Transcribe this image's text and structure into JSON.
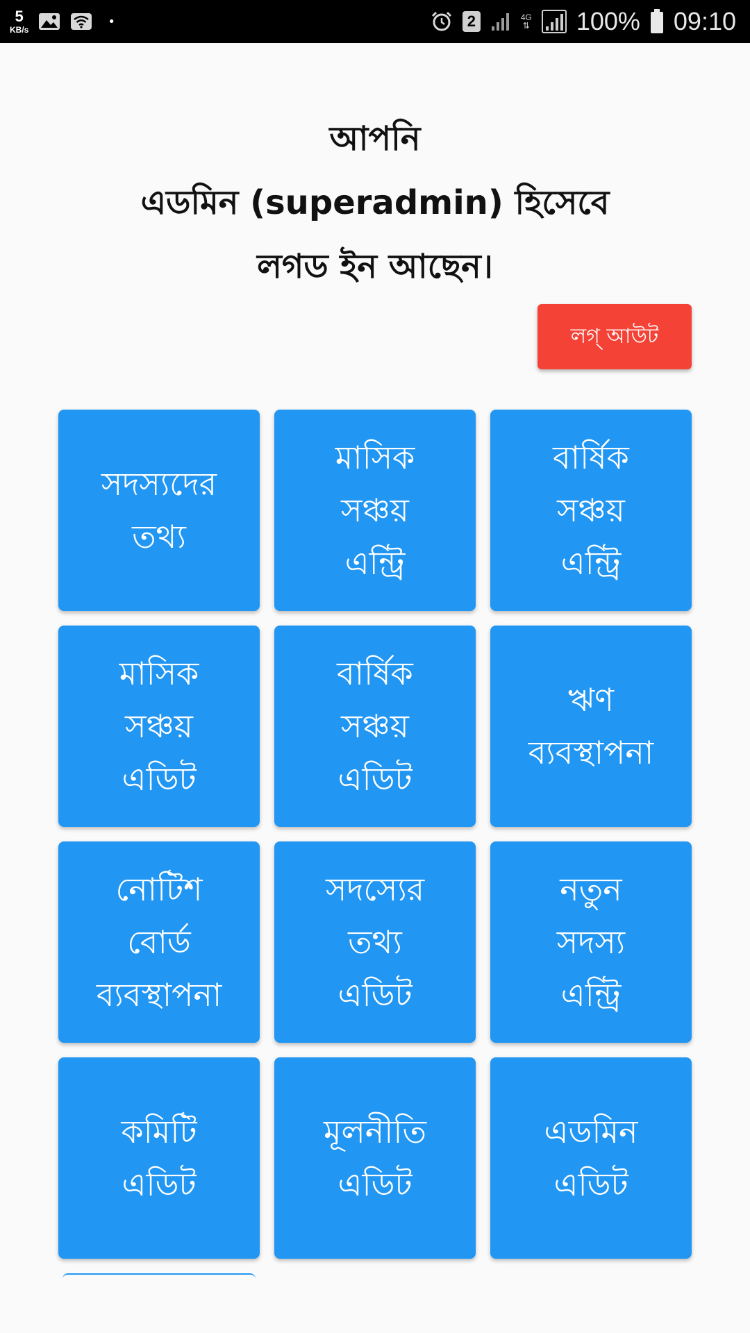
{
  "status_bar": {
    "speed_value": "5",
    "speed_unit": "KB/s",
    "dot": "•",
    "sim_badge": "2",
    "network_type": "4G",
    "battery_percent": "100%",
    "time": "09:10"
  },
  "header": {
    "line1": "আপনি",
    "line2": "এডমিন (superadmin) হিসেবে",
    "line3": "লগড ইন আছেন।"
  },
  "logout_label": "লগ্ আউট",
  "colors": {
    "tile_blue": "#2196f3",
    "logout_red": "#f44336"
  },
  "tiles": [
    "সদস্যদের\nতথ্য",
    "মাসিক\nসঞ্চয়\nএন্ট্রি",
    "বার্ষিক\nসঞ্চয়\nএন্ট্রি",
    "মাসিক\nসঞ্চয়\nএডিট",
    "বার্ষিক\nসঞ্চয়\nএডিট",
    "ঋণ\nব্যবস্থাপনা",
    "নোটিশ\nবোর্ড\nব্যবস্থাপনা",
    "সদস্যের\nতথ্য\nএডিট",
    "নতুন\nসদস্য\nএন্ট্রি",
    "কমিটি\nএডিট",
    "মূলনীতি\nএডিট",
    "এডমিন\nএডিট"
  ]
}
